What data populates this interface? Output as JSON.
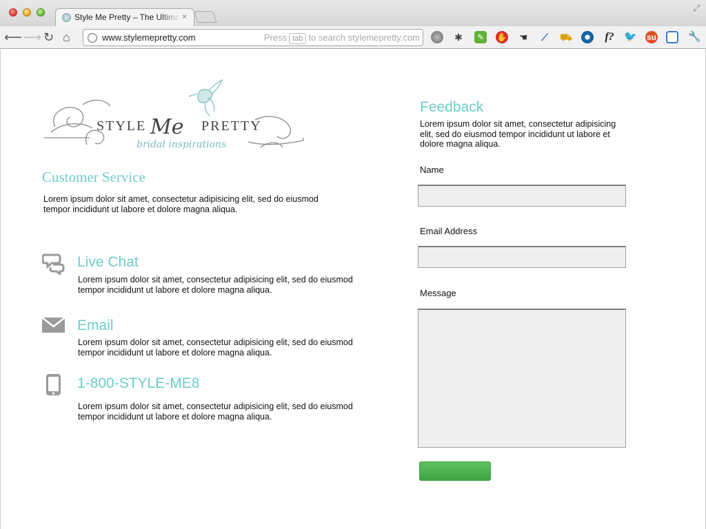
{
  "browser": {
    "tab_title": "Style Me Pretty – The Ultimate Wedding Blog",
    "tab_close": "×",
    "url": "www.stylemepretty.com",
    "omnibox_hint_pre": "Press",
    "omnibox_hint_key": "tab",
    "omnibox_hint_post": "to search stylemepretty.com",
    "extensions": [
      "gear-icon",
      "bug-icon",
      "evernote-icon",
      "adblock-icon",
      "hand-icon",
      "eyedropper-icon",
      "truck-icon",
      "eye-icon",
      "font-finder-icon",
      "bird-icon",
      "stumbleupon-icon",
      "screen-capture-icon",
      "wrench-icon"
    ]
  },
  "logo": {
    "word_style": "STYLE",
    "word_me": "Me",
    "word_pretty": "PRETTY",
    "tagline": "bridal inspirations"
  },
  "customer_service": {
    "heading": "Customer Service",
    "text": "Lorem ipsum dolor sit amet, consectetur adipisicing elit, sed do eiusmod tempor incididunt ut labore et dolore magna aliqua."
  },
  "contacts": [
    {
      "title": "Live Chat",
      "icon": "chat-bubble-icon",
      "text": "Lorem ipsum dolor sit amet, consectetur adipisicing elit, sed do eiusmod tempor incididunt ut labore et dolore magna aliqua."
    },
    {
      "title": "Email",
      "icon": "envelope-icon",
      "text": "Lorem ipsum dolor sit amet, consectetur adipisicing elit, sed do eiusmod tempor incididunt ut labore et dolore magna aliqua."
    },
    {
      "title": "1-800-STYLE-ME8",
      "icon": "phone-icon",
      "text": "Lorem ipsum dolor sit amet, consectetur adipisicing elit, sed do eiusmod tempor incididunt ut labore et dolore magna aliqua."
    }
  ],
  "feedback": {
    "heading": "Feedback",
    "text": "Lorem ipsum dolor sit amet, consectetur adipisicing elit, sed do eiusmod tempor incididunt ut labore et dolore magna aliqua.",
    "name_label": "Name",
    "name_value": "",
    "email_label": "Email Address",
    "email_value": "",
    "message_label": "Message",
    "message_value": "",
    "submit_label": ""
  },
  "colors": {
    "accent": "#6fcbcb",
    "submit": "#4caf50",
    "field_bg": "#efefef"
  }
}
